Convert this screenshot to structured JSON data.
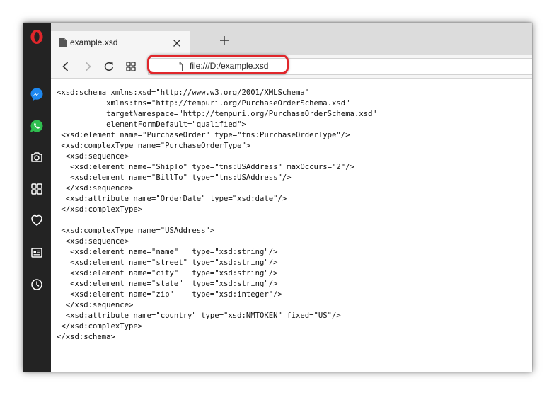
{
  "browser": {
    "tab": {
      "title": "example.xsd"
    },
    "new_tab_label": "+",
    "address": "file:///D:/example.xsd"
  },
  "sidebar": {
    "icons": [
      "opera-logo-icon",
      "messenger-icon",
      "whatsapp-icon",
      "camera-icon",
      "speed-dial-icon",
      "heart-icon",
      "news-icon",
      "history-icon"
    ]
  },
  "colors": {
    "sidebar": "#232323",
    "highlight": "#e0262b",
    "opera_red": "#e0262b"
  },
  "document": {
    "lines": [
      "<xsd:schema xmlns:xsd=\"http://www.w3.org/2001/XMLSchema\"",
      "           xmlns:tns=\"http://tempuri.org/PurchaseOrderSchema.xsd\"",
      "           targetNamespace=\"http://tempuri.org/PurchaseOrderSchema.xsd\"",
      "           elementFormDefault=\"qualified\">",
      " <xsd:element name=\"PurchaseOrder\" type=\"tns:PurchaseOrderType\"/>",
      " <xsd:complexType name=\"PurchaseOrderType\">",
      "  <xsd:sequence>",
      "   <xsd:element name=\"ShipTo\" type=\"tns:USAddress\" maxOccurs=\"2\"/>",
      "   <xsd:element name=\"BillTo\" type=\"tns:USAddress\"/>",
      "  </xsd:sequence>",
      "  <xsd:attribute name=\"OrderDate\" type=\"xsd:date\"/>",
      " </xsd:complexType>",
      "",
      " <xsd:complexType name=\"USAddress\">",
      "  <xsd:sequence>",
      "   <xsd:element name=\"name\"   type=\"xsd:string\"/>",
      "   <xsd:element name=\"street\" type=\"xsd:string\"/>",
      "   <xsd:element name=\"city\"   type=\"xsd:string\"/>",
      "   <xsd:element name=\"state\"  type=\"xsd:string\"/>",
      "   <xsd:element name=\"zip\"    type=\"xsd:integer\"/>",
      "  </xsd:sequence>",
      "  <xsd:attribute name=\"country\" type=\"xsd:NMTOKEN\" fixed=\"US\"/>",
      " </xsd:complexType>",
      "</xsd:schema>"
    ]
  }
}
